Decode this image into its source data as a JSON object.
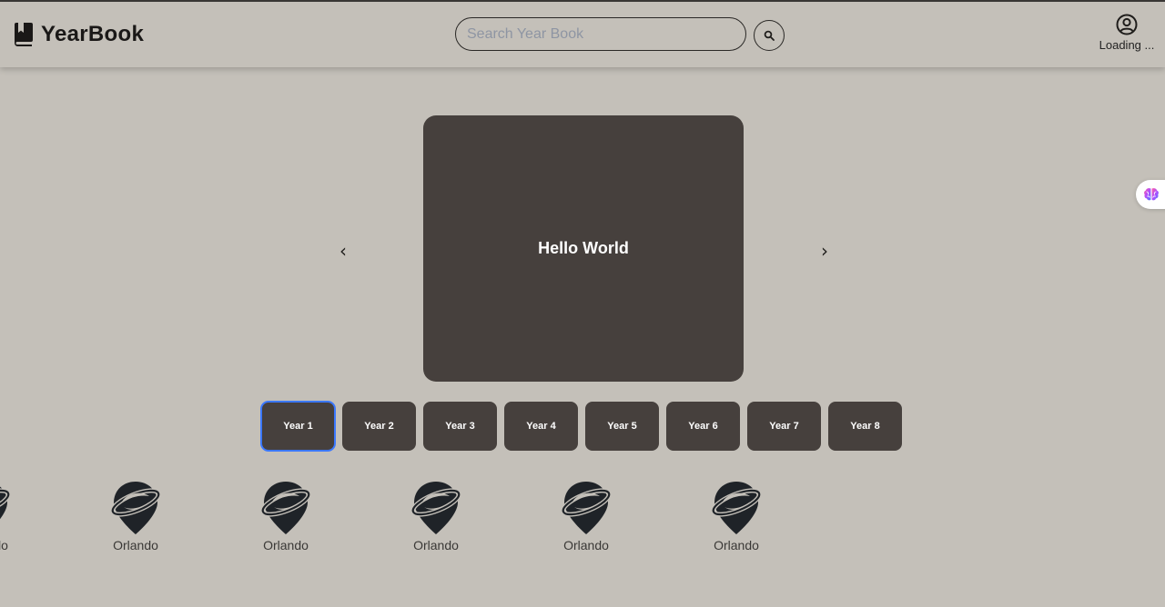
{
  "header": {
    "brand": {
      "name": "YearBook",
      "icon": "book-icon"
    },
    "search": {
      "placeholder": "Search Year Book",
      "value": "",
      "button_icon": "search-icon"
    },
    "user": {
      "icon": "user-circle-icon",
      "status": "Loading ..."
    }
  },
  "side_widget": {
    "icon": "brain-icon"
  },
  "carousel": {
    "prev_label": "‹",
    "next_label": "›",
    "slide_text": "Hello World"
  },
  "years": [
    {
      "label": "Year 1",
      "active": true
    },
    {
      "label": "Year 2",
      "active": false
    },
    {
      "label": "Year 3",
      "active": false
    },
    {
      "label": "Year 4",
      "active": false
    },
    {
      "label": "Year 5",
      "active": false
    },
    {
      "label": "Year 6",
      "active": false
    },
    {
      "label": "Year 7",
      "active": false
    },
    {
      "label": "Year 8",
      "active": false
    }
  ],
  "locations": [
    {
      "label": "Orlando",
      "icon": "planet-pin-icon"
    },
    {
      "label": "Orlando",
      "icon": "planet-pin-icon"
    },
    {
      "label": "Orlando",
      "icon": "planet-pin-icon"
    },
    {
      "label": "Orlando",
      "icon": "planet-pin-icon"
    },
    {
      "label": "Orlando",
      "icon": "planet-pin-icon"
    },
    {
      "label": "Orlando",
      "icon": "planet-pin-icon"
    }
  ],
  "colors": {
    "background": "#c4c0b9",
    "card": "#46403d",
    "active_outline": "#3b78ff",
    "text_dark": "#1f1d1b"
  }
}
